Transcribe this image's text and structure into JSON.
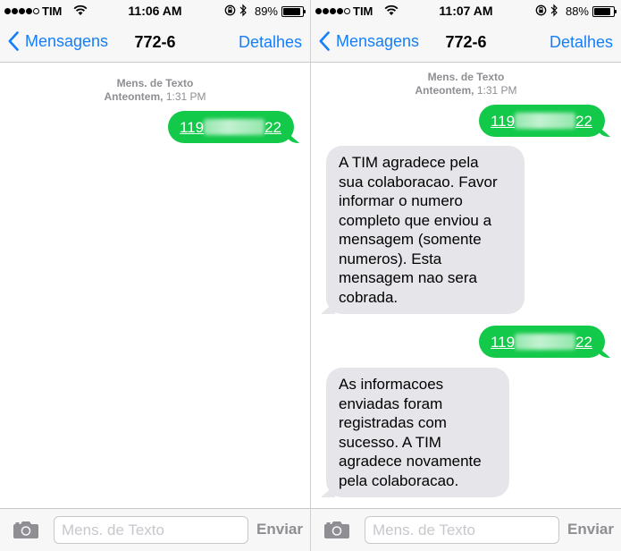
{
  "colors": {
    "accent": "#157efb",
    "outgoing_bubble": "#13c94a",
    "incoming_bubble": "#e5e5ea"
  },
  "screens": [
    {
      "status": {
        "carrier": "TIM",
        "time": "11:06 AM",
        "battery": "89%",
        "battery_level": 0.89
      },
      "nav": {
        "back": "Mensagens",
        "title": "772-6",
        "details": "Detalhes"
      },
      "timestamp": {
        "type": "Mens. de Texto",
        "day": "Anteontem,",
        "time": "1:31 PM"
      },
      "messages": [
        {
          "from": "me",
          "prefix": "119",
          "suffix": "22"
        }
      ],
      "input": {
        "placeholder": "Mens. de Texto",
        "send": "Enviar"
      }
    },
    {
      "status": {
        "carrier": "TIM",
        "time": "11:07 AM",
        "battery": "88%",
        "battery_level": 0.88
      },
      "nav": {
        "back": "Mensagens",
        "title": "772-6",
        "details": "Detalhes"
      },
      "timestamp": {
        "type": "Mens. de Texto",
        "day": "Anteontem,",
        "time": "1:31 PM"
      },
      "messages": [
        {
          "from": "me",
          "prefix": "119",
          "suffix": "22"
        },
        {
          "from": "them",
          "lines": [
            "A TIM agradece pela",
            "sua colaboracao. Favor",
            "informar o numero",
            "completo que enviou a",
            "mensagem (somente",
            "numeros). Esta",
            "mensagem nao sera",
            "cobrada."
          ]
        },
        {
          "from": "me",
          "prefix": "119",
          "suffix": "22"
        },
        {
          "from": "them",
          "lines": [
            "As informacoes",
            "enviadas foram",
            "registradas com",
            "sucesso. A TIM",
            "agradece novamente",
            "pela colaboracao."
          ]
        }
      ],
      "input": {
        "placeholder": "Mens. de Texto",
        "send": "Enviar"
      }
    }
  ]
}
